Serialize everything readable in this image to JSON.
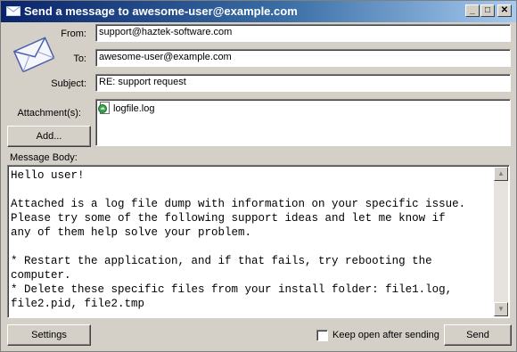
{
  "window": {
    "title": "Send a message to awesome-user@example.com",
    "minimize_glyph": "_",
    "maximize_glyph": "□",
    "close_glyph": "✕"
  },
  "form": {
    "from_label": "From:",
    "from_value": "support@haztek-software.com",
    "to_label": "To:",
    "to_value": "awesome-user@example.com",
    "subject_label": "Subject:",
    "subject_value": "RE: support request",
    "attachments_label": "Attachment(s):",
    "attachments": [
      {
        "name": "logfile.log",
        "icon": "log-file-icon"
      }
    ],
    "add_button": "Add...",
    "body_label": "Message Body:",
    "body_text": "Hello user!\n\nAttached is a log file dump with information on your specific issue.\nPlease try some of the following support ideas and let me know if\nany of them help solve your problem.\n\n* Restart the application, and if that fails, try rebooting the\ncomputer.\n* Delete these specific files from your install folder: file1.log,\nfile2.pid, file2.tmp"
  },
  "footer": {
    "settings_button": "Settings",
    "keep_open_label": "Keep open after sending",
    "keep_open_checked": false,
    "send_button": "Send"
  },
  "icons": {
    "app": "envelope-icon",
    "scroll_up": "scroll-up-arrow-icon",
    "scroll_down": "scroll-down-arrow-icon"
  }
}
